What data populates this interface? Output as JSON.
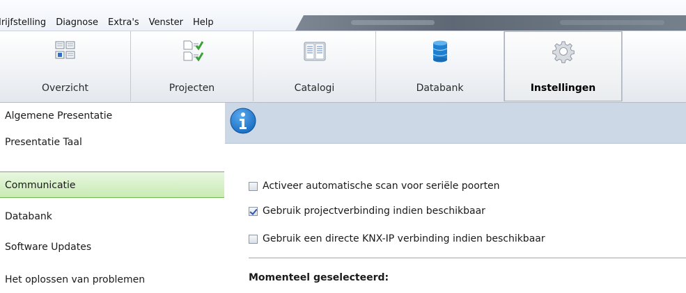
{
  "menubar": {
    "items": [
      "Irijfstelling",
      "Diagnose",
      "Extra's",
      "Venster",
      "Help"
    ]
  },
  "toolbar": {
    "buttons": [
      {
        "label": "Overzicht",
        "icon": "overview-grid-icon"
      },
      {
        "label": "Projecten",
        "icon": "projects-checklist-icon"
      },
      {
        "label": "Catalogi",
        "icon": "catalog-book-icon"
      },
      {
        "label": "Databank",
        "icon": "database-icon"
      },
      {
        "label": "Instellingen",
        "icon": "settings-gear-icon",
        "active": true
      }
    ]
  },
  "sidebar": {
    "items": [
      {
        "label": "Algemene Presentatie"
      },
      {
        "label": "Presentatie Taal"
      },
      {
        "label": "Communicatie",
        "active": true
      },
      {
        "label": "Databank"
      },
      {
        "label": "Software Updates"
      },
      {
        "label": "Het oplossen van problemen"
      }
    ]
  },
  "main": {
    "info_icon": "info-icon",
    "options": [
      {
        "label": "Activeer automatische scan voor seriële poorten",
        "checked": false
      },
      {
        "label": "Gebruik projectverbinding indien beschikbaar",
        "checked": true
      },
      {
        "label": "Gebruik een directe KNX-IP verbinding indien beschikbaar",
        "checked": false
      }
    ],
    "selected_heading": "Momenteel geselecteerd:"
  },
  "colors": {
    "active_nav_bg": "#c9ebb4",
    "active_nav_border": "#6fba4d",
    "info_bar_bg": "#ccd8e6",
    "info_icon_blue": "#1a6fc4",
    "checkmark": "#2b56b5"
  }
}
